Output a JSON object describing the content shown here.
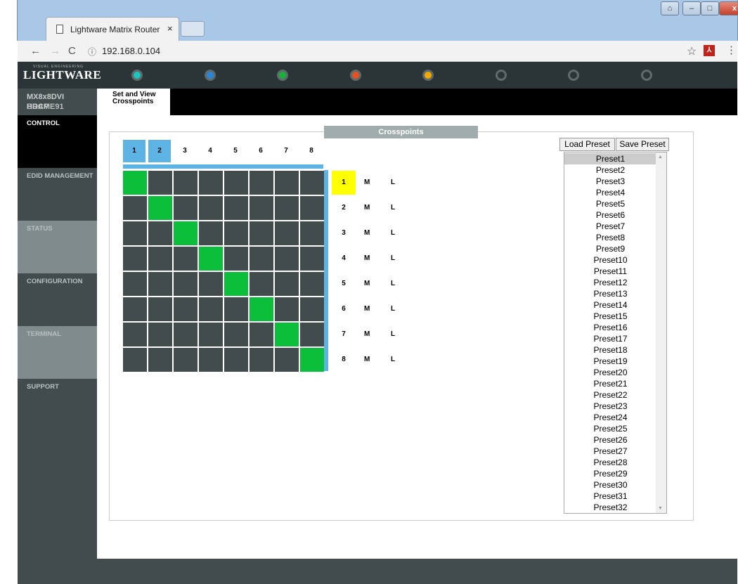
{
  "browser": {
    "tab_title": "Lightware Matrix Router",
    "tab_close": "×",
    "url_info_icon": "ⓘ",
    "url": "192.168.0.104",
    "nav_back": "←",
    "nav_forward": "→",
    "nav_reload": "C",
    "star_icon": "☆",
    "pdf_icon": "⅄",
    "menu_icon": "⋮",
    "window_user_icon": "⌂",
    "window_min": "–",
    "window_max": "□",
    "window_close": "x"
  },
  "app": {
    "logo_text": "LIGHTWARE",
    "logo_sub": "VISUAL ENGINEERING",
    "device_line1": "MX8x8DVI",
    "device_line2": "HDCP",
    "device_line3": "BRAME91",
    "status_dots": [
      "#19c7c0",
      "#2b85d6",
      "#16b33a",
      "#e8501f",
      "#f2a900",
      "#2b3436",
      "#2b3436",
      "#2b3436"
    ],
    "subtab_label_1": "Set and View",
    "subtab_label_2": "Crosspoints",
    "menu": {
      "control": "CONTROL",
      "edid": "EDID MANAGEMENT",
      "status": "STATUS",
      "configuration": "CONFIGURATION",
      "terminal": "TERMINAL",
      "support": "SUPPORT"
    }
  },
  "crosspoints": {
    "title": "Crosspoints",
    "inputs": [
      "1",
      "2",
      "3",
      "4",
      "5",
      "6",
      "7",
      "8"
    ],
    "selected_inputs": [
      1,
      2
    ],
    "outputs": [
      "1",
      "2",
      "3",
      "4",
      "5",
      "6",
      "7",
      "8"
    ],
    "selected_output": 1,
    "mute_label": "M",
    "lock_label": "L",
    "connections": [
      1,
      2,
      3,
      4,
      5,
      6,
      7,
      8
    ]
  },
  "presets": {
    "load_label": "Load Preset",
    "save_label": "Save Preset",
    "selected": "Preset1",
    "items": [
      "Preset1",
      "Preset2",
      "Preset3",
      "Preset4",
      "Preset5",
      "Preset6",
      "Preset7",
      "Preset8",
      "Preset9",
      "Preset10",
      "Preset11",
      "Preset12",
      "Preset13",
      "Preset14",
      "Preset15",
      "Preset16",
      "Preset17",
      "Preset18",
      "Preset19",
      "Preset20",
      "Preset21",
      "Preset22",
      "Preset23",
      "Preset24",
      "Preset25",
      "Preset26",
      "Preset27",
      "Preset28",
      "Preset29",
      "Preset30",
      "Preset31",
      "Preset32"
    ]
  }
}
